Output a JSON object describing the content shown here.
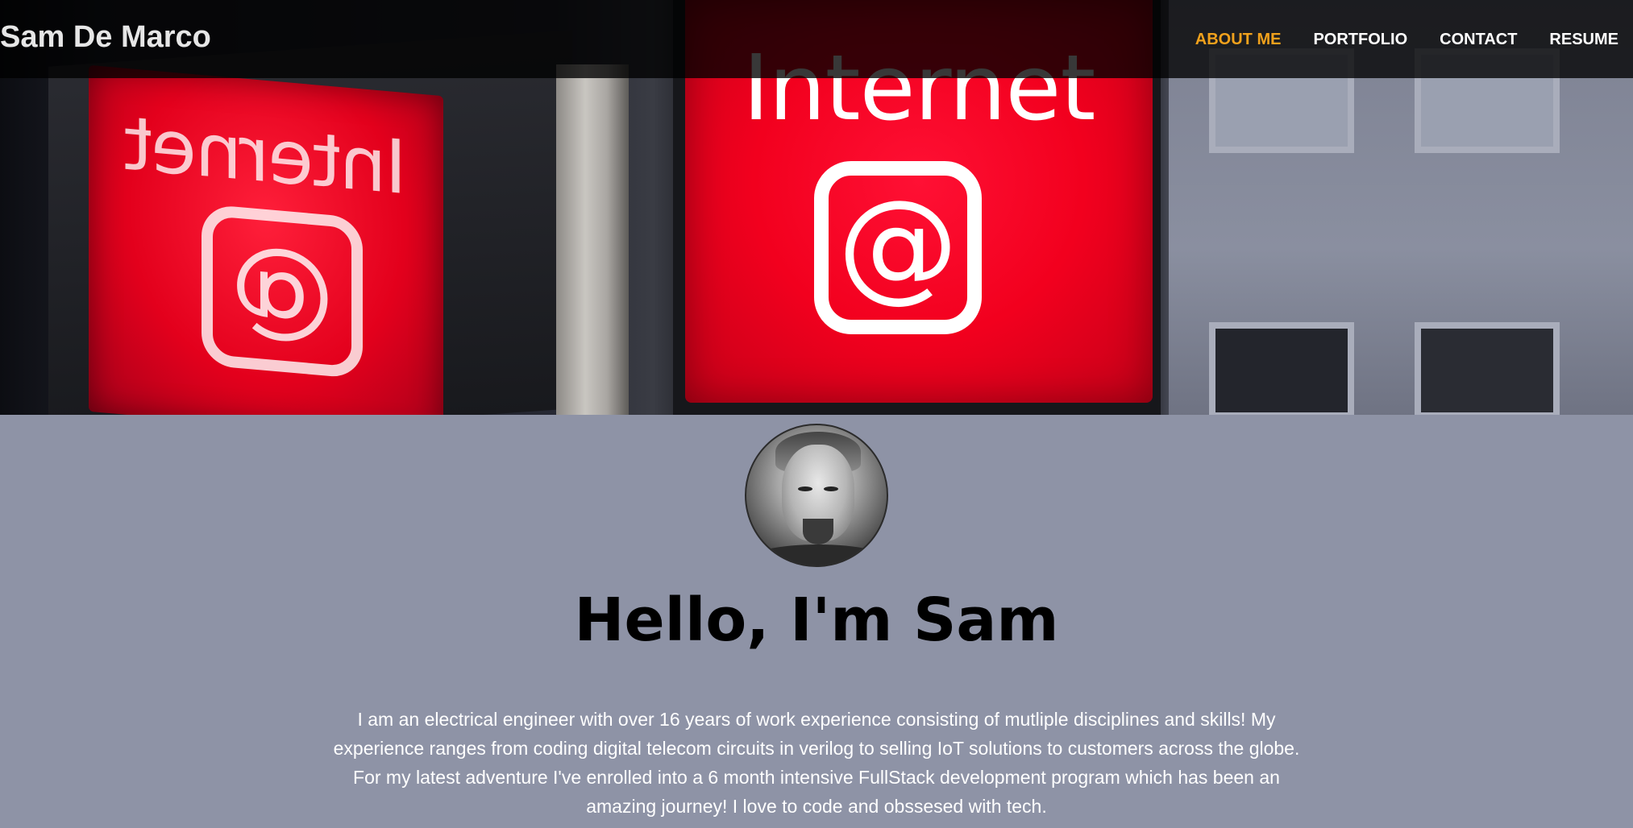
{
  "header": {
    "brand": "Sam De Marco",
    "nav": [
      {
        "label": "ABOUT ME",
        "active": true
      },
      {
        "label": "PORTFOLIO",
        "active": false
      },
      {
        "label": "CONTACT",
        "active": false
      },
      {
        "label": "RESUME",
        "active": false
      }
    ],
    "active_color": "#f0a11c"
  },
  "hero": {
    "sign_text": "Internet",
    "sign_symbol": "@"
  },
  "about": {
    "avatar_icon": "profile-photo",
    "greeting": "Hello, I'm Sam",
    "bio": "I am an electrical engineer with over 16 years of work experience consisting of mutliple disciplines and skills! My experience ranges from coding digital telecom circuits in verilog to selling IoT solutions to customers across the globe. For my latest adventure I've enrolled into a 6 month intensive FullStack development program which has been an amazing journey! I love to code and obssesed with tech.",
    "background_color": "#8e93a6"
  }
}
